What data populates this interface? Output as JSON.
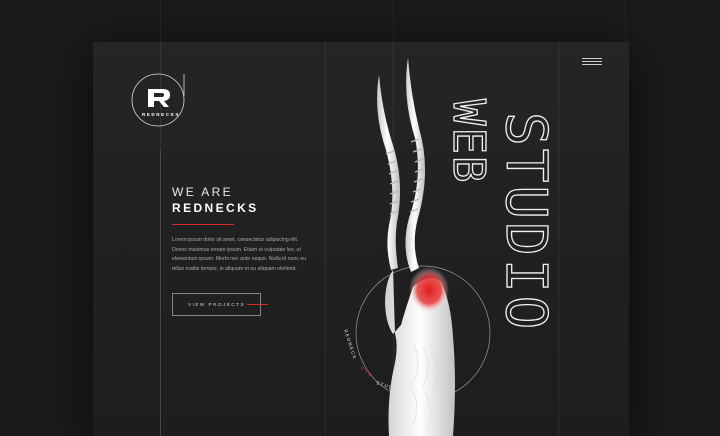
{
  "logo": {
    "text": "REDNECKS"
  },
  "hero": {
    "line1": "WE ARE",
    "line2": "REDNECKS",
    "paragraph": "Lorem ipsum dolor sit amet, consectetur adipiscing elit. Donec maximus ornare ipsum. Etiam ut vulputate leo, ut elementum ipsum. Morbi nec ante neque. Nulla id nunc eu tellus mattis tempor, in aliquam et eu aliquam eleifend."
  },
  "cta": {
    "label": "VIEW PROJECTS"
  },
  "art": {
    "word1": "WEB",
    "word2": "STUDIO",
    "circle_text_white1": "REDNECK",
    "circle_text_red": "WEB",
    "circle_text_white2": "STUDIO"
  },
  "colors": {
    "accent": "#d72b2b",
    "background": "#1a1a1b",
    "card": "#232324"
  },
  "icons": {
    "menu": "hamburger-icon",
    "logo": "r-logo-icon"
  }
}
